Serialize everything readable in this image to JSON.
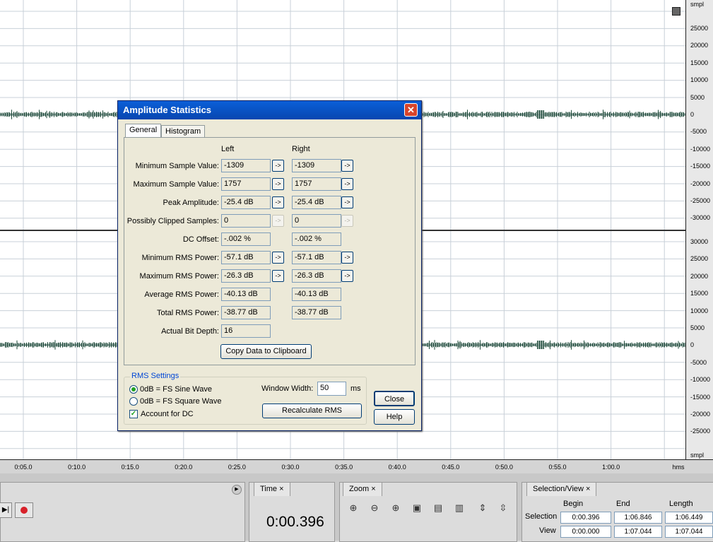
{
  "waveform": {
    "vruler_unit": "smpl",
    "vruler_top": [
      "25000",
      "20000",
      "15000",
      "10000",
      "5000",
      "0",
      "-5000",
      "-10000",
      "-15000",
      "-20000",
      "-25000",
      "-30000"
    ],
    "vruler_bottom": [
      "30000",
      "25000",
      "20000",
      "15000",
      "10000",
      "5000",
      "0",
      "-5000",
      "-10000",
      "-15000",
      "-20000",
      "-25000"
    ],
    "vruler_bottom_unit": "smpl",
    "timeline": [
      "0:05.0",
      "0:10.0",
      "0:15.0",
      "0:20.0",
      "0:25.0",
      "0:30.0",
      "0:35.0",
      "0:40.0",
      "0:45.0",
      "0:50.0",
      "0:55.0",
      "1:00.0"
    ],
    "timeline_unit": "hms",
    "wave_color": "#1e4a3a"
  },
  "dialog": {
    "title": "Amplitude Statistics",
    "tabs": [
      "General",
      "Histogram"
    ],
    "col_left": "Left",
    "col_right": "Right",
    "rows": [
      {
        "label": "Minimum Sample Value:",
        "left": "-1309",
        "right": "-1309",
        "arrow": "active"
      },
      {
        "label": "Maximum Sample Value:",
        "left": "1757",
        "right": "1757",
        "arrow": "active"
      },
      {
        "label": "Peak Amplitude:",
        "left": "-25.4 dB",
        "right": "-25.4 dB",
        "arrow": "active"
      },
      {
        "label": "Possibly Clipped Samples:",
        "left": "0",
        "right": "0",
        "arrow": "disabled"
      },
      {
        "label": "DC Offset:",
        "left": "-.002 %",
        "right": "-.002 %",
        "arrow": "none"
      },
      {
        "label": "Minimum RMS Power:",
        "left": "-57.1 dB",
        "right": "-57.1 dB",
        "arrow": "active"
      },
      {
        "label": "Maximum RMS Power:",
        "left": "-26.3 dB",
        "right": "-26.3 dB",
        "arrow": "active"
      },
      {
        "label": "Average RMS Power:",
        "left": "-40.13 dB",
        "right": "-40.13 dB",
        "arrow": "none"
      },
      {
        "label": "Total RMS Power:",
        "left": "-38.77 dB",
        "right": "-38.77 dB",
        "arrow": "none"
      },
      {
        "label": "Actual Bit Depth:",
        "left": "16",
        "right": "",
        "arrow": "none"
      }
    ],
    "arrow_glyph": "->",
    "copy_button": "Copy Data to Clipboard",
    "rms": {
      "legend": "RMS Settings",
      "sine": "0dB = FS Sine Wave",
      "square": "0dB = FS Square Wave",
      "dc": "Account for DC",
      "window_label": "Window Width:",
      "window_value": "50",
      "window_unit": "ms",
      "recalc": "Recalculate RMS"
    },
    "close_button": "Close",
    "help_button": "Help",
    "close_glyph": "✕"
  },
  "bottom": {
    "time_tab": "Time",
    "time_value": "0:00.396",
    "zoom_tab": "Zoom",
    "sel_tab": "Selection/View",
    "tab_close": "×",
    "sel_begin": "Begin",
    "sel_end": "End",
    "sel_length": "Length",
    "sel_row_label": "Selection",
    "view_row_label": "View",
    "selection": [
      "0:00.396",
      "1:06.846",
      "1:06.449"
    ],
    "view": [
      "0:00.000",
      "1:07.044",
      "1:07.044"
    ]
  }
}
